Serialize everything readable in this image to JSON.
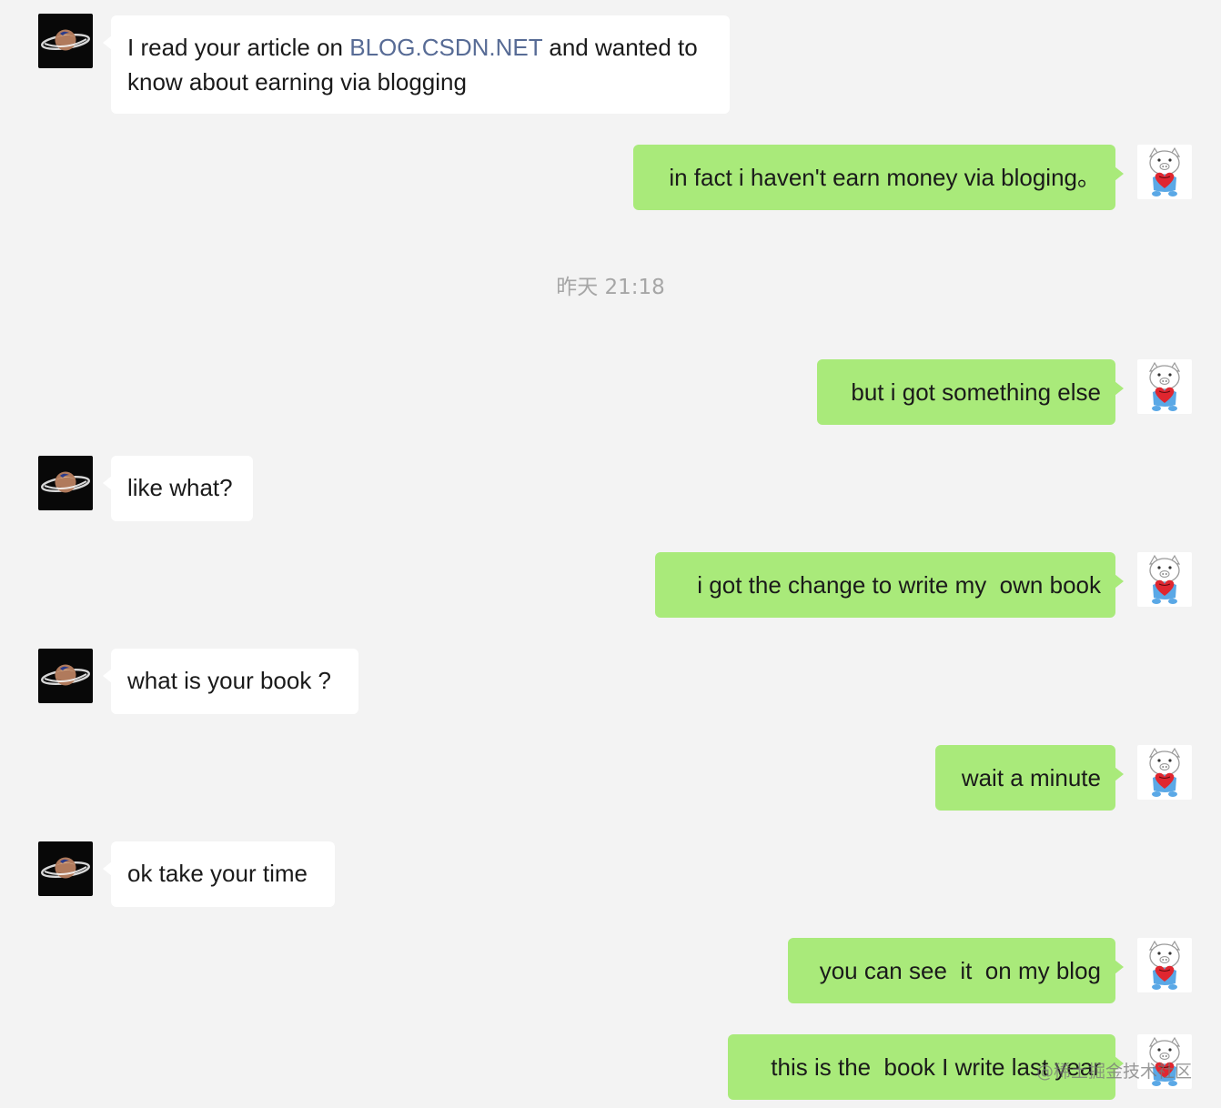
{
  "timestamp": "昨天 21:18",
  "messages": [
    {
      "from": "them",
      "prefix": "I read your article on ",
      "link": "BLOG.CSDN.NET",
      "suffix": " and wanted to",
      "line2": "know about earning via blogging"
    },
    {
      "from": "me",
      "text": "in fact i haven't earn money via bloging。"
    },
    {
      "from": "me",
      "text": "but i got something else"
    },
    {
      "from": "them",
      "text": "like what?"
    },
    {
      "from": "me",
      "text": "i got the change to write my  own book"
    },
    {
      "from": "them",
      "text": "what is your book ?"
    },
    {
      "from": "me",
      "text": "wait a minute"
    },
    {
      "from": "them",
      "text": "ok take your time"
    },
    {
      "from": "me",
      "text": "you can see  it  on my blog"
    },
    {
      "from": "me",
      "text": "this is the  book I write last year"
    }
  ],
  "watermark": "@稀土掘金技术社区",
  "colors": {
    "background": "#f3f3f3",
    "outgoing_bubble": "#a9ea7a",
    "incoming_bubble": "#ffffff",
    "link": "#576b95",
    "timestamp": "#a6a6a6"
  },
  "icons": {
    "contact_avatar": "saturn-planet-avatar-icon",
    "my_avatar": "pig-with-heart-avatar-icon"
  }
}
